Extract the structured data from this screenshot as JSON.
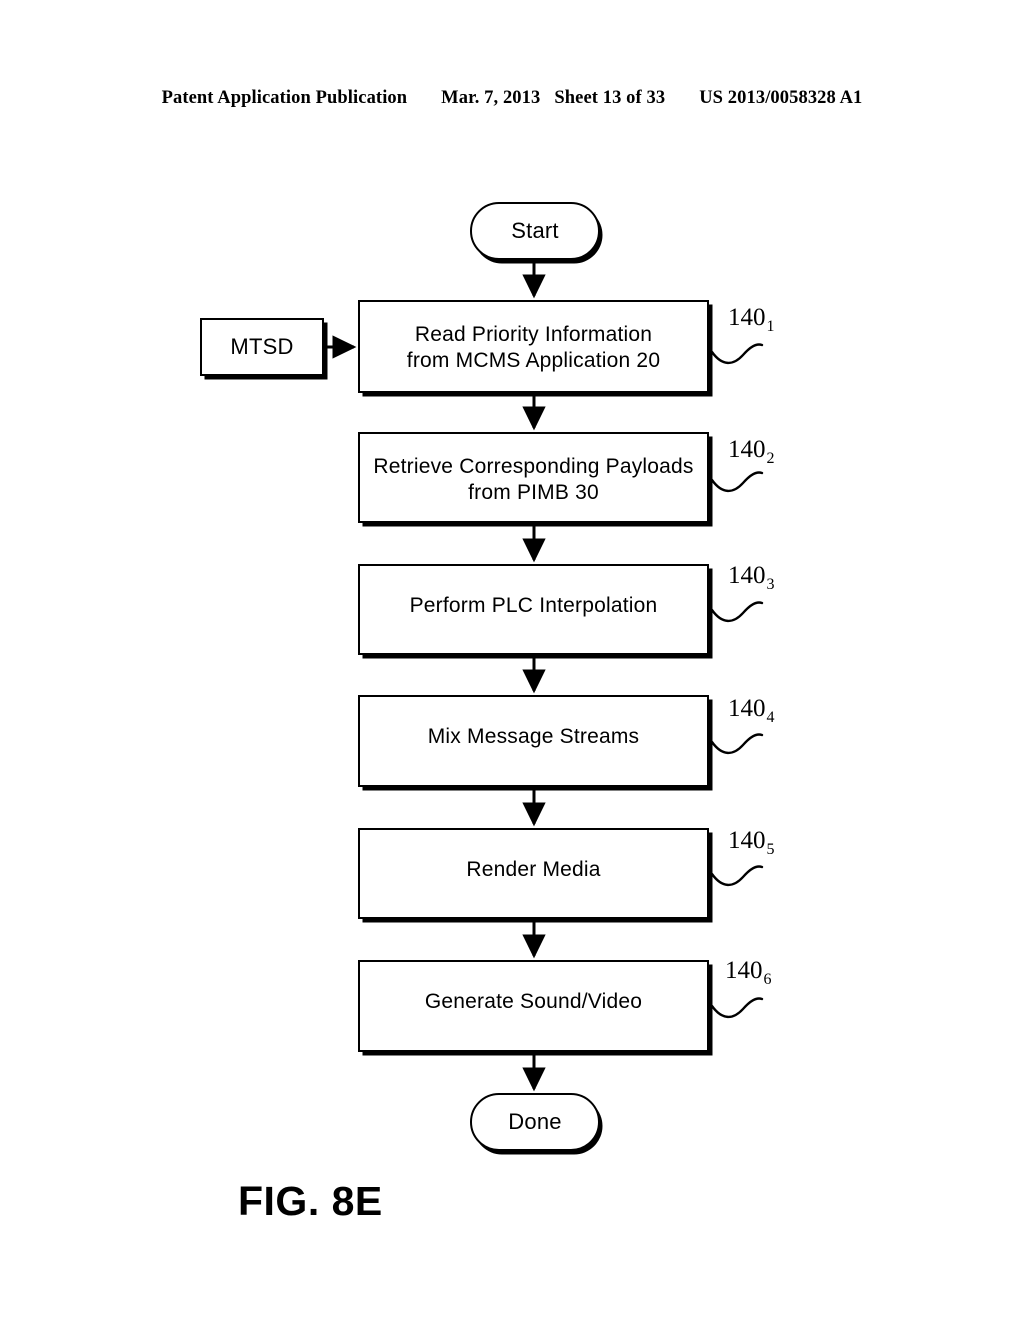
{
  "header": {
    "publication": "Patent Application Publication",
    "date": "Mar. 7, 2013",
    "sheet": "Sheet 13 of 33",
    "patent_number": "US 2013/0058328 A1"
  },
  "figure": {
    "caption": "FIG. 8E"
  },
  "flowchart": {
    "start_label": "Start",
    "end_label": "Done",
    "side_input": {
      "label": "MTSD"
    },
    "steps": [
      {
        "label": "Read Priority Information\nfrom MCMS Application 20",
        "ref_base": "140",
        "ref_sub": "1"
      },
      {
        "label": "Retrieve Corresponding Payloads\nfrom PIMB 30",
        "ref_base": "140",
        "ref_sub": "2"
      },
      {
        "label": "Perform PLC Interpolation",
        "ref_base": "140",
        "ref_sub": "3"
      },
      {
        "label": "Mix Message Streams",
        "ref_base": "140",
        "ref_sub": "4"
      },
      {
        "label": "Render Media",
        "ref_base": "140",
        "ref_sub": "5"
      },
      {
        "label": "Generate Sound/Video",
        "ref_base": "140",
        "ref_sub": "6"
      }
    ]
  },
  "colors": {
    "ink": "#000000",
    "page": "#ffffff"
  }
}
